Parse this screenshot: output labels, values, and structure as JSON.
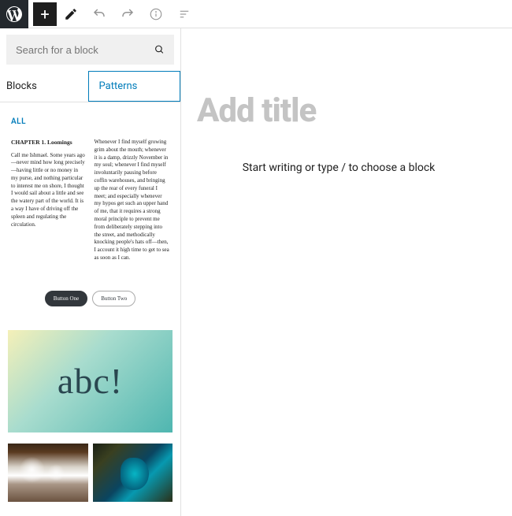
{
  "topbar": {
    "add_tooltip": "Add block"
  },
  "search": {
    "placeholder": "Search for a block"
  },
  "tabs": {
    "blocks": "Blocks",
    "patterns": "Patterns"
  },
  "filter": {
    "all": "ALL"
  },
  "patterns": {
    "text2col": {
      "heading": "CHAPTER 1. Loomings",
      "col1": "Call me Ishmael. Some years ago—never mind how long precisely—having little or no money in my purse, and nothing particular to interest me on shore, I thought I would sail about a little and see the watery part of the world. It is a way I have of driving off the spleen and regulating the circulation.",
      "col2": "Whenever I find myself growing grim about the mouth; whenever it is a damp, drizzly November in my soul; whenever I find myself involuntarily pausing before coffin warehouses, and bringing up the rear of every funeral I meet; and especially whenever my hypos get such an upper hand of me, that it requires a strong moral principle to prevent me from deliberately stepping into the street, and methodically knocking people's hats off—then, I account it high time to get to sea as soon as I can."
    },
    "buttons": {
      "primary": "Button One",
      "secondary": "Button Two"
    },
    "cover": {
      "text": "abc!"
    }
  },
  "editor": {
    "title_placeholder": "Add title",
    "body_placeholder": "Start writing or type / to choose a block"
  }
}
